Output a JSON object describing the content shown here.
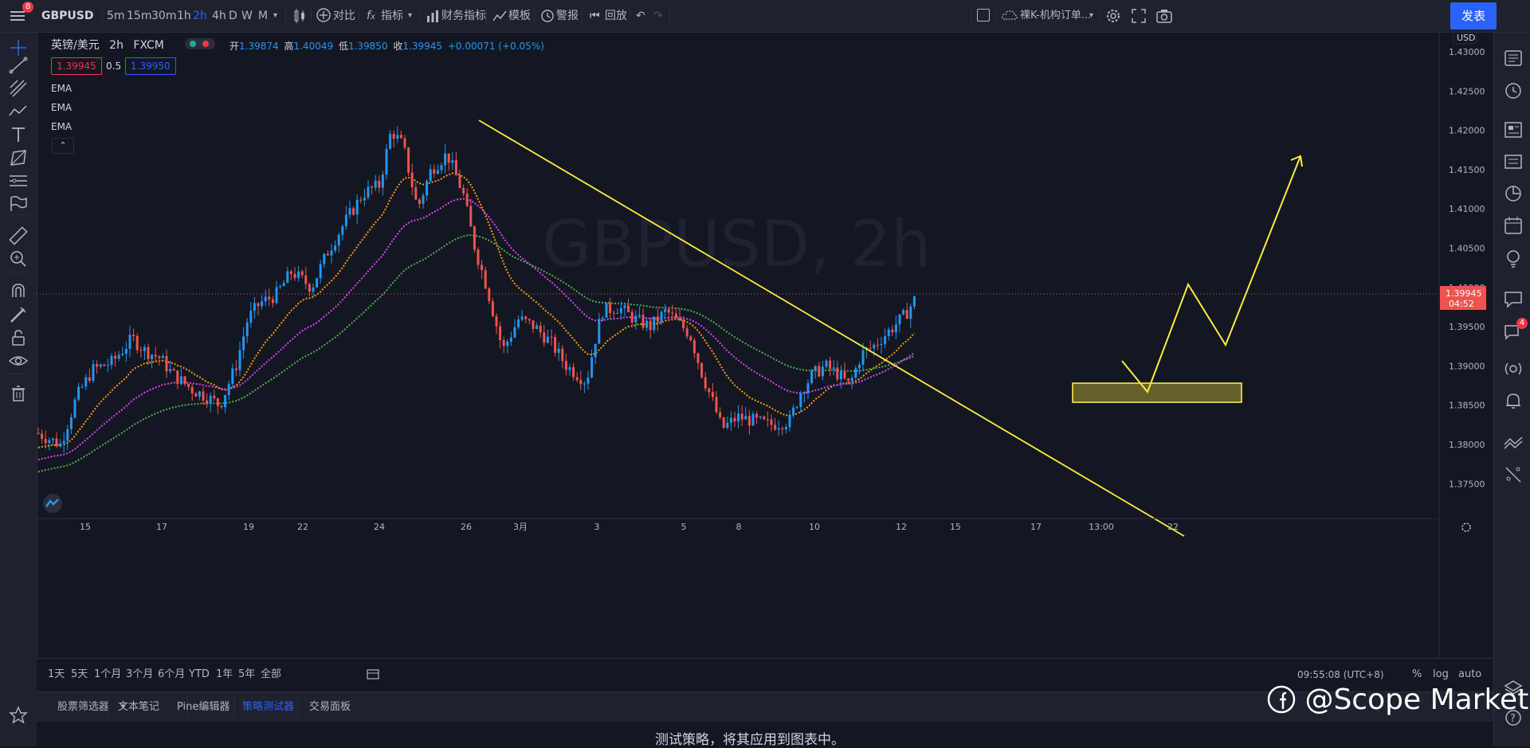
{
  "toolbar": {
    "symbol": "GBPUSD",
    "timeframes": [
      "5m",
      "15m",
      "30m",
      "1h",
      "2h",
      "4h",
      "D",
      "W",
      "M"
    ],
    "active_timeframe": "2h",
    "compare": "对比",
    "indicators": "指标",
    "financials": "财务指标",
    "templates": "模板",
    "alert": "警报",
    "replay": "回放",
    "layout_name": "裸K-机构订单...",
    "publish": "发表",
    "menu_badge": "8"
  },
  "legend": {
    "title": "英镑/美元",
    "interval": "2h",
    "exchange": "FXCM",
    "open_label": "开",
    "open": "1.39874",
    "high_label": "高",
    "high": "1.40049",
    "low_label": "低",
    "low": "1.39850",
    "close_label": "收",
    "close": "1.39945",
    "change": "+0.00071 (+0.05%)",
    "bid": "1.39945",
    "spread": "0.5",
    "ask": "1.39950",
    "indicators": [
      "EMA",
      "EMA",
      "EMA"
    ]
  },
  "chart_data": {
    "type": "candlestick",
    "symbol_watermark": "GBPUSD, 2h",
    "currency": "USD",
    "y_ticks": [
      "1.43000",
      "1.42500",
      "1.42000",
      "1.41500",
      "1.41000",
      "1.40500",
      "1.40000",
      "1.39500",
      "1.39000",
      "1.38500",
      "1.38000",
      "1.37500"
    ],
    "last_price": "1.39945",
    "countdown": "04:52",
    "x_ticks": [
      "15",
      "17",
      "19",
      "22",
      "24",
      "26",
      "3月",
      "3",
      "5",
      "8",
      "10",
      "12",
      "15",
      "17",
      "13:00",
      "22"
    ],
    "ema_colors": [
      "#ff9800",
      "#e040fb",
      "#4caf50"
    ],
    "up_color": "#2196f3",
    "down_color": "#ef5350",
    "annotation_color": "#ffeb3b"
  },
  "timebar": {
    "ranges": [
      "1天",
      "5天",
      "1个月",
      "3个月",
      "6个月",
      "YTD",
      "1年",
      "5年",
      "全部"
    ],
    "clock": "09:55:08 (UTC+8)",
    "percent": "%",
    "log": "log",
    "auto": "auto"
  },
  "panel": {
    "tabs": [
      "股票筛选器",
      "文本笔记",
      "Pine编辑器",
      "策略测试器",
      "交易面板"
    ],
    "active_tab": "策略测试器",
    "message": "测试策略，将其应用到图表中。"
  },
  "watermark": "@Scope Markets",
  "alerts_badge": "4"
}
